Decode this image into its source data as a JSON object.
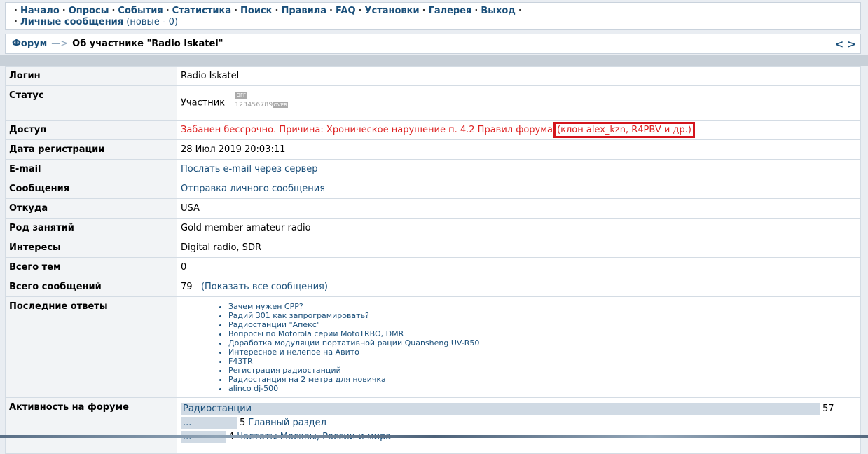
{
  "nav": {
    "items": [
      "Начало",
      "Опросы",
      "События",
      "Статистика",
      "Поиск",
      "Правила",
      "FAQ",
      "Установки",
      "Галерея",
      "Выход"
    ],
    "pm_label": "Личные сообщения",
    "pm_new": "(новые - 0)"
  },
  "breadcrumb": {
    "forum": "Форум",
    "arrow": "—>",
    "current": "Об участнике \"Radio Iskatel\"",
    "prev": "<",
    "next": ">"
  },
  "profile": {
    "login_label": "Логин",
    "login": "Radio Iskatel",
    "status_label": "Статус",
    "status": "Участник",
    "rank_off": "OFF",
    "rank_digits": "123456789",
    "rank_over": "OVER",
    "access_label": "Доступ",
    "access_text": "Забанен бессрочно. Причина: Хроническое нарушение п. 4.2 Правил форума",
    "access_note": "(клон alex_kzn, R4PBV и др.)",
    "reg_label": "Дата регистрации",
    "reg": "28 Июл 2019 20:03:11",
    "email_label": "E-mail",
    "email": "Послать e-mail через сервер",
    "msg_label": "Сообщения",
    "msg": "Отправка личного сообщения",
    "from_label": "Откуда",
    "from": "USA",
    "occ_label": "Род занятий",
    "occ": "Gold member amateur radio",
    "int_label": "Интересы",
    "int": "Digital radio, SDR",
    "topics_label": "Всего тем",
    "topics": "0",
    "posts_label": "Всего сообщений",
    "posts": "79",
    "posts_link": "(Показать все сообщения)",
    "replies_label": "Последние ответы",
    "replies": [
      "Зачем нужен CPP?",
      "Радий 301 как запрограмировать?",
      "Радиостанции \"Апекс\"",
      "Вопросы по Motorola серии MotoTRBO, DMR",
      "Доработка модуляции портативной рации Quansheng UV-R50",
      "Интересное и нелепое на Авито",
      "F43TR",
      "Регистрация радиостанций",
      "Радиостанция на 2 метра для новичка",
      "alinco dj-500"
    ],
    "activity_label": "Активность на форуме",
    "activity": [
      {
        "bar": "Радиостанции",
        "count": "57",
        "name": "",
        "fill": 1.0
      },
      {
        "bar": "...",
        "count": "5",
        "name": "Главный раздел",
        "fill": 0.088
      },
      {
        "bar": "...",
        "count": "4",
        "name": "Частоты Москвы, России и мира",
        "fill": 0.07
      }
    ]
  }
}
